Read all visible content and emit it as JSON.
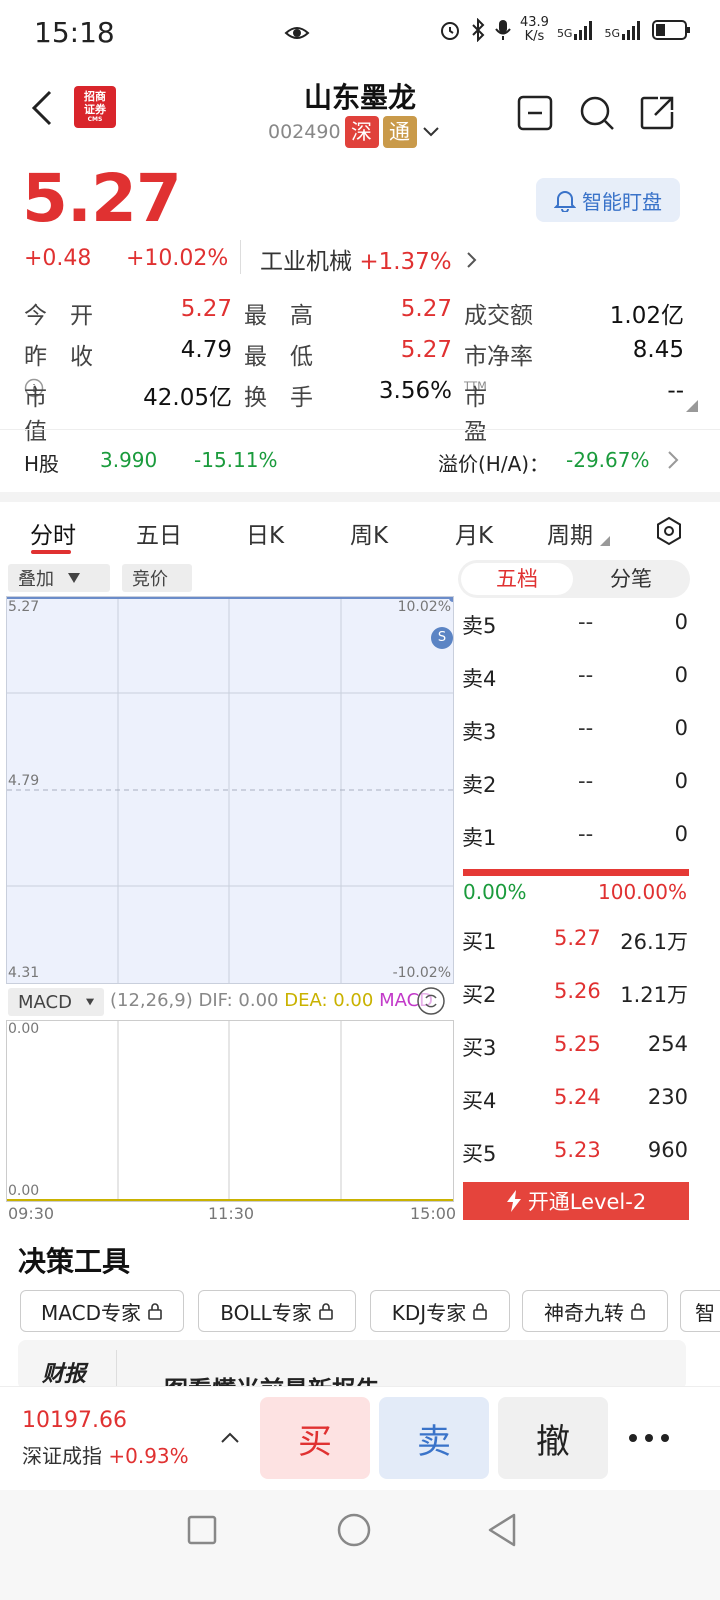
{
  "status_bar": {
    "time": "15:18",
    "net_speed_value": "43.9",
    "net_speed_unit": "K/s",
    "sig1": "5G",
    "sig2": "5G"
  },
  "header": {
    "logo_line1": "招商",
    "logo_line2": "证券",
    "logo_line3": "CMS",
    "stock_name": "山东墨龙",
    "stock_code": "002490",
    "tag_shen": "深",
    "tag_tong": "通"
  },
  "quote": {
    "price": "5.27",
    "change": "+0.48",
    "change_pct": "+10.02%",
    "industry_name": "工业机械",
    "industry_pct": "+1.37%",
    "smart_watch": "智能盯盘",
    "rows": [
      [
        {
          "label": "今　开",
          "value": "5.27"
        },
        {
          "label": "最　高",
          "value": "5.27"
        },
        {
          "label": "成交额",
          "value": "1.02亿"
        }
      ],
      [
        {
          "label": "昨　收",
          "value": "4.79"
        },
        {
          "label": "最　低",
          "value": "5.27"
        },
        {
          "label": "市净率",
          "value": "8.45"
        }
      ],
      [
        {
          "label": "市值",
          "value": "42.05亿"
        },
        {
          "label": "换　手",
          "value": "3.56%"
        },
        {
          "label": "市盈",
          "label_sup": "TTM",
          "value": "--"
        }
      ]
    ]
  },
  "h_share": {
    "label": "H股",
    "price": "3.990",
    "pct": "-15.11%",
    "premium_label": "溢价(H/A)：",
    "premium_value": "-29.67%"
  },
  "tabs": [
    "分时",
    "五日",
    "日K",
    "周K",
    "月K",
    "周期"
  ],
  "chart": {
    "overlay": "叠加",
    "auction": "竞价",
    "y_top_left": "5.27",
    "y_mid_left": "4.79",
    "y_bot_left": "4.31",
    "y_top_right": "10.02%",
    "y_bot_right": "-10.02%",
    "marker": "S",
    "macd_label": "MACD",
    "macd_params": "(12,26,9)",
    "dif": "DIF: 0.00",
    "dea": "DEA: 0.00",
    "macd_val": "MACD",
    "macd_top": "0.00",
    "macd_bot": "0.00",
    "x_labels": [
      "09:30",
      "11:30",
      "15:00"
    ]
  },
  "chart_data": {
    "type": "line",
    "x": [
      "09:30",
      "11:30",
      "15:00"
    ],
    "series": [],
    "ylim": [
      4.31,
      5.27
    ],
    "y_ticks": [
      "5.27",
      "4.79",
      "4.31"
    ],
    "y2_ticks": [
      "10.02%",
      "-10.02%"
    ]
  },
  "orderbook": {
    "seg_active": "五档",
    "seg_inactive": "分笔",
    "asks": [
      {
        "label": "卖5",
        "price": "--",
        "vol": "0"
      },
      {
        "label": "卖4",
        "price": "--",
        "vol": "0"
      },
      {
        "label": "卖3",
        "price": "--",
        "vol": "0"
      },
      {
        "label": "卖2",
        "price": "--",
        "vol": "0"
      },
      {
        "label": "卖1",
        "price": "--",
        "vol": "0"
      }
    ],
    "ratio_buy": "0.00%",
    "ratio_sell": "100.00%",
    "bids": [
      {
        "label": "买1",
        "price": "5.27",
        "vol": "26.1万"
      },
      {
        "label": "买2",
        "price": "5.26",
        "vol": "1.21万"
      },
      {
        "label": "买3",
        "price": "5.25",
        "vol": "254"
      },
      {
        "label": "买4",
        "price": "5.24",
        "vol": "230"
      },
      {
        "label": "买5",
        "price": "5.23",
        "vol": "960"
      }
    ],
    "level2": "开通Level-2"
  },
  "tools": {
    "title": "决策工具",
    "items": [
      "MACD专家",
      "BOLL专家",
      "KDJ专家",
      "神奇九转",
      "智"
    ],
    "report_logo": "财报",
    "report_text": "一图看懂当前最新报告"
  },
  "bottom": {
    "index_value": "10197.66",
    "index_name": "深证成指",
    "index_pct": "+0.93%",
    "buy": "买",
    "sell": "卖",
    "cancel": "撤"
  }
}
